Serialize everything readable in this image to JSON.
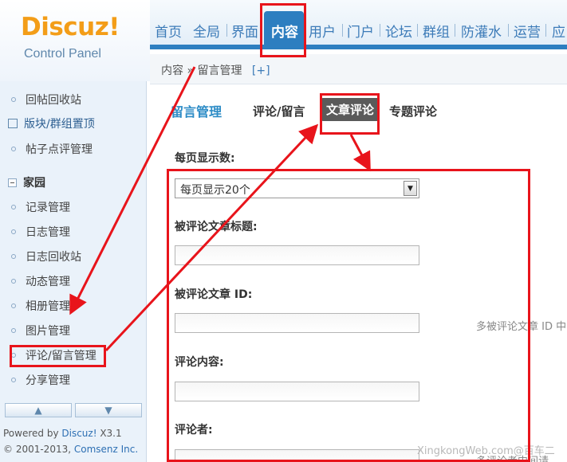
{
  "logo": {
    "brand": "Discuz!",
    "subtitle": "Control Panel"
  },
  "topnav": {
    "items": [
      "首页",
      "全局",
      "界面",
      "内容",
      "用户",
      "门户",
      "论坛",
      "群组",
      "防灌水",
      "运营",
      "应"
    ],
    "active_index": 3
  },
  "breadcrumb": {
    "path": "内容 » 留言管理",
    "plus": "[+]"
  },
  "sidebar": {
    "items_top": [
      "回帖回收站",
      "版块/群组置顶",
      "帖子点评管理"
    ],
    "group": "家园",
    "items_group": [
      "记录管理",
      "日志管理",
      "日志回收站",
      "动态管理",
      "相册管理",
      "图片管理",
      "评论/留言管理",
      "分享管理"
    ],
    "powered_prefix": "Powered by ",
    "powered_link": "Discuz!",
    "powered_version": " X3.1",
    "copyright_prefix": "© 2001-2013, ",
    "copyright_link": "Comsenz Inc."
  },
  "main": {
    "title": "留言管理",
    "tabs": [
      "评论/留言",
      "文章评论",
      "专题评论"
    ],
    "active_tab": 1,
    "per_page_label": "每页显示数:",
    "per_page_value": "每页显示20个",
    "article_title_label": "被评论文章标题:",
    "article_id_label": "被评论文章 ID:",
    "article_id_hint": "多被评论文章 ID 中",
    "content_label": "评论内容:",
    "author_label": "评论者:",
    "author_hint": "多评论者中间请",
    "watermark": "XingkongWeb.com@百车二"
  },
  "colors": {
    "accent": "#2d7ec0",
    "logo_orange": "#f39d18",
    "annotation_red": "#e8141b"
  }
}
